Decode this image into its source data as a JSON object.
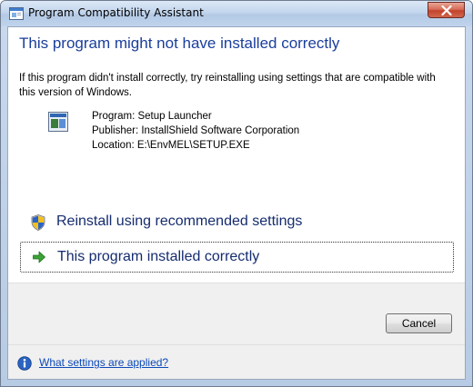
{
  "window": {
    "title": "Program Compatibility Assistant",
    "close_icon": "close-icon"
  },
  "main_instruction": "This program might not have installed correctly",
  "content_text": "If this program didn't install correctly, try reinstalling using settings that are compatible with this version of Windows.",
  "program_details": {
    "program_line": "Program: Setup Launcher",
    "publisher_line": "Publisher: InstallShield Software Corporation",
    "location_line": "Location: E:\\EnvMEL\\SETUP.EXE"
  },
  "commands": [
    {
      "label": "Reinstall using recommended settings",
      "icon": "shield-icon"
    },
    {
      "label": "This program installed correctly",
      "icon": "green-arrow-icon"
    }
  ],
  "footer": {
    "cancel_label": "Cancel",
    "help_link": "What settings are applied?",
    "help_icon": "info-icon"
  },
  "colors": {
    "main_instruction": "#1a3e9c",
    "command_link_text": "#152c6e",
    "help_link": "#0b49b8"
  }
}
